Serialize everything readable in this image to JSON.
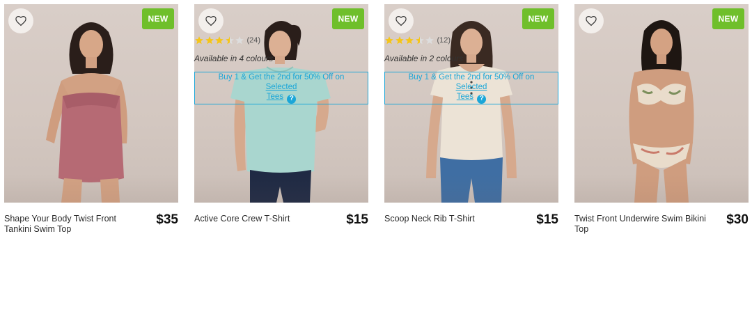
{
  "products": [
    {
      "badge": "NEW",
      "name": "Shape Your Body Twist Front Tankini Swim Top",
      "price": "$35",
      "garment_color": "#b66a74",
      "icons": {
        "favorite": "heart-outline-icon"
      }
    },
    {
      "badge": "NEW",
      "name": "Active Core Crew T-Shirt",
      "price": "$15",
      "rating": 3.5,
      "review_count": "(24)",
      "availability": "Available in 4 colours",
      "promo": {
        "text": "Buy 1 & Get the 2nd for 50% Off on ",
        "link_line1": "Selected",
        "link_line2": "Tees",
        "help_icon": "question-circle-icon"
      },
      "garment_color": "#a9d6cf"
    },
    {
      "badge": "NEW",
      "name": "Scoop Neck Rib T-Shirt",
      "price": "$15",
      "rating": 3.5,
      "review_count": "(12)",
      "availability": "Available in 2 colours",
      "promo": {
        "text": "Buy 1 & Get the 2nd for 50% Off on ",
        "link_line1": "Selected",
        "link_line2": "Tees",
        "help_icon": "question-circle-icon"
      },
      "garment_color": "#ece3d6"
    },
    {
      "badge": "NEW",
      "name": "Twist Front Underwire Swim Bikini Top",
      "price": "$30",
      "garment_color": "#e9dccb"
    }
  ],
  "colors": {
    "badge_green": "#6fbf2b",
    "promo_blue": "#1aa6d8",
    "star_gold": "#f5c518",
    "star_empty": "#dddddd"
  }
}
